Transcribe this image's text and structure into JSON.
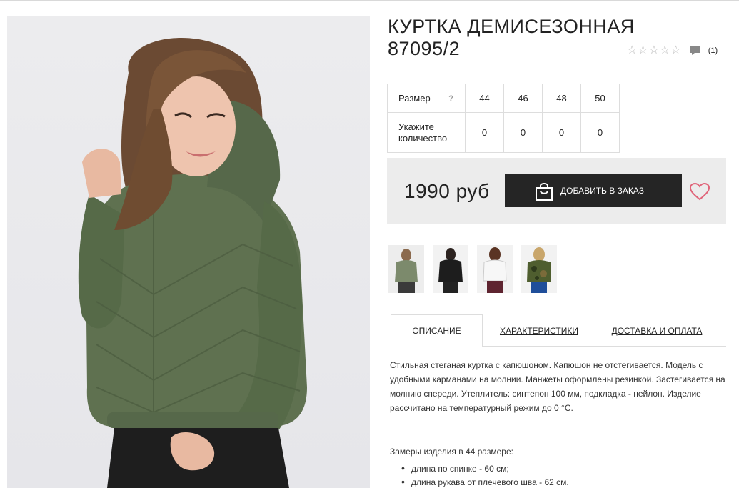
{
  "product": {
    "title_line1": "КУРТКА ДЕМИСЕЗОННАЯ",
    "title_line2": "87095/2",
    "review_count": "(1)",
    "jacket_color": "#5f7150"
  },
  "sizes": {
    "size_label": "Размер",
    "help_symbol": "?",
    "quantity_label": "Укажите количество",
    "values": [
      "44",
      "46",
      "48",
      "50"
    ],
    "quantities": [
      "0",
      "0",
      "0",
      "0"
    ]
  },
  "buy": {
    "price": "1990 руб",
    "add_button_label": "ДОБАВИТЬ В ЗАКАЗ"
  },
  "tabs": {
    "description": "ОПИСАНИЕ",
    "specs": "ХАРАКТЕРИСТИКИ",
    "delivery": "ДОСТАВКА И ОПЛАТА"
  },
  "description": {
    "text": "Стильная стеганая куртка с капюшоном. Капюшон не отстегивается. Модель с удобными карманами на молнии. Манжеты оформлены резинкой. Застегивается на молнию спереди. Утеплитель: синтепон 100 мм, подкладка - нейлон. Изделие рассчитано на температурный режим до 0 °С.",
    "measure_title": "Замеры изделия в 44 размере:",
    "measures": [
      "длина по спинке - 60 см;",
      "длина рукава от плечевого шва - 62 см."
    ]
  }
}
